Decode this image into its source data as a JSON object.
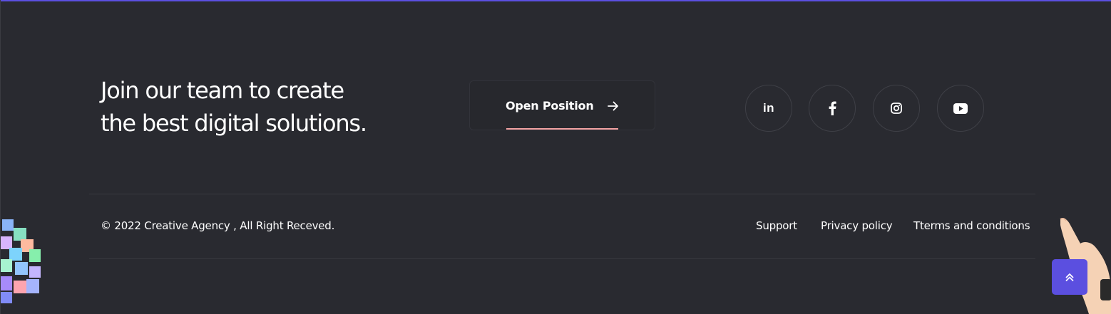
{
  "cta": {
    "headline_line1": "Join our team to create",
    "headline_line2": "the best digital solutions.",
    "button_label": "Open Position"
  },
  "social": [
    {
      "name": "linkedin",
      "icon": "linkedin-icon",
      "glyph": "in"
    },
    {
      "name": "facebook",
      "icon": "facebook-icon"
    },
    {
      "name": "instagram",
      "icon": "instagram-icon"
    },
    {
      "name": "youtube",
      "icon": "youtube-icon"
    }
  ],
  "footer": {
    "copyright": "© 2022 Creative Agency , All Right Receved.",
    "links": [
      "Support",
      "Privacy policy",
      "Tterms and conditions"
    ]
  },
  "colors": {
    "background": "#292a30",
    "accent": "#5b4fe0",
    "underline": "#f3a3a3"
  }
}
